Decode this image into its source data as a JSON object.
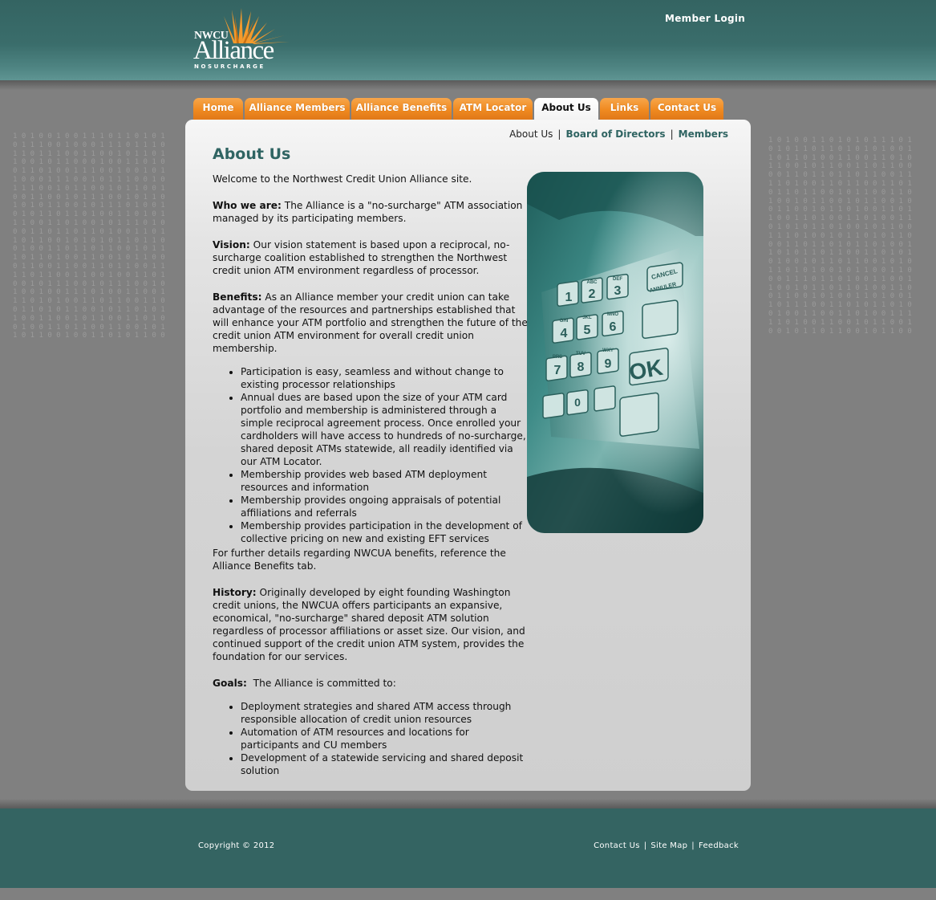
{
  "header": {
    "logo": {
      "top": "NWCU",
      "name": "Alliance",
      "tagline": "NOSURCHARGE"
    },
    "member_login": "Member Login"
  },
  "nav": {
    "tabs": [
      {
        "label": "Home",
        "active": false
      },
      {
        "label": "Alliance Members",
        "active": false
      },
      {
        "label": "Alliance Benefits",
        "active": false
      },
      {
        "label": "ATM Locator",
        "active": false
      },
      {
        "label": "About Us",
        "active": true
      },
      {
        "label": "Links",
        "active": false
      },
      {
        "label": "Contact Us",
        "active": false
      }
    ]
  },
  "subnav": {
    "current": "About Us",
    "links": [
      "Board of Directors",
      "Members"
    ]
  },
  "main": {
    "title": "About Us",
    "intro": "Welcome to the Northwest Credit Union Alliance site.",
    "who": {
      "label": "Who we are:",
      "text": " The Alliance is a \"no-surcharge\" ATM association managed by its participating members."
    },
    "vision": {
      "label": "Vision:",
      "text": " Our vision statement is based upon a reciprocal, no-surcharge coalition established to strengthen the Northwest credit union ATM environment regardless of processor."
    },
    "benefits": {
      "label": "Benefits:",
      "text": " As an Alliance member your credit union can take advantage of the resources and partnerships established that will enhance your ATM portfolio and strengthen the future of the credit union ATM environment for overall credit union membership.",
      "items": [
        "Participation is easy, seamless and without change to existing processor relationships",
        "Annual dues are based upon the size of your ATM card portfolio and membership is administered through a simple reciprocal agreement process. Once enrolled your cardholders will have access to hundreds of no-surcharge, shared deposit ATMs statewide, all readily identified via our ATM Locator.",
        "Membership provides web based ATM deployment resources and information",
        "Membership provides ongoing appraisals of potential affiliations and referrals",
        "Membership provides participation in the development of collective pricing on new and existing EFT services"
      ],
      "footer": "For further details regarding NWCUA benefits, reference the Alliance Benefits tab."
    },
    "history": {
      "label": "History:",
      "text": " Originally developed by eight founding Washington credit unions, the NWCUA offers participants an expansive, economical, \"no-surcharge\" shared deposit ATM solution regardless of processor affiliations or asset size. Our vision, and continued support of the credit union ATM system, provides the foundation for our services."
    },
    "goals": {
      "label": "Goals:",
      "text": "  The Alliance is committed to:",
      "items": [
        "Deployment strategies and shared ATM access through responsible allocation of credit union resources",
        "Automation of ATM resources and locations for participants and CU members",
        "Development of a statewide servicing and shared deposit solution"
      ]
    },
    "keypad": {
      "keys": [
        "1",
        "2",
        "3",
        "4",
        "5",
        "6",
        "7",
        "8",
        "9",
        "0"
      ],
      "letters": [
        "ABC",
        "DEF",
        "GHI",
        "JKL",
        "MNO",
        "PRS",
        "TUV",
        "WXY"
      ],
      "cancel": "CANCEL",
      "cancel_fr": "ANNULER",
      "ok": "OK"
    }
  },
  "footer": {
    "copyright": "Copyright © 2012",
    "links": [
      "Contact Us",
      "Site Map",
      "Feedback"
    ]
  },
  "colors": {
    "teal": "#346462",
    "orange": "#f08a20",
    "link": "#2f6462"
  }
}
